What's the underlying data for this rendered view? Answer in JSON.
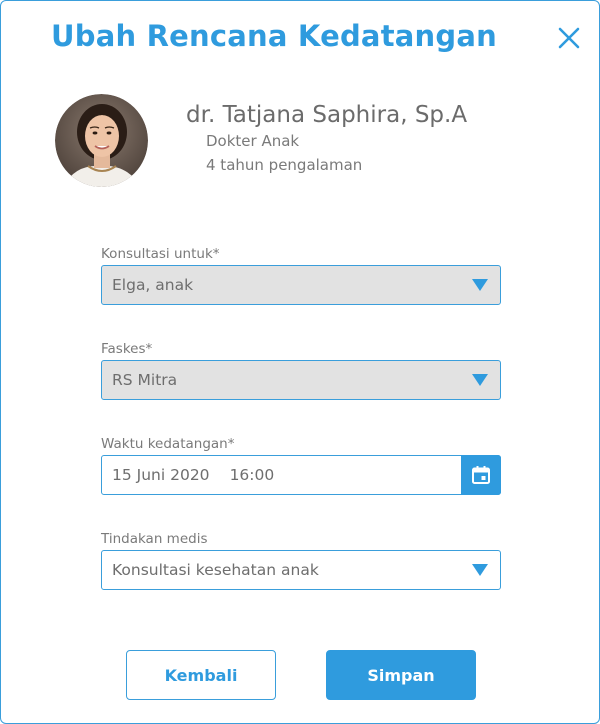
{
  "dialog": {
    "title": "Ubah Rencana Kedatangan",
    "close_icon": "close-icon"
  },
  "doctor": {
    "name": "dr. Tatjana Saphira, Sp.A",
    "specialty": "Dokter Anak",
    "experience": "4 tahun pengalaman",
    "avatar_icon": "doctor-avatar"
  },
  "form": {
    "consult_for": {
      "label": "Konsultasi untuk*",
      "value": "Elga, anak"
    },
    "facility": {
      "label": "Faskes*",
      "value": "RS Mitra"
    },
    "arrival_time": {
      "label": "Waktu kedatangan*",
      "date": "15 Juni 2020",
      "time": "16:00",
      "icon": "calendar-icon"
    },
    "procedure": {
      "label": "Tindakan medis",
      "value": "Konsultasi kesehatan anak"
    }
  },
  "actions": {
    "back_label": "Kembali",
    "save_label": "Simpan"
  },
  "colors": {
    "accent": "#2f9bde",
    "border": "#3a9edb",
    "disabled_bg": "#e2e2e2",
    "text_muted": "#7a7a7a"
  }
}
